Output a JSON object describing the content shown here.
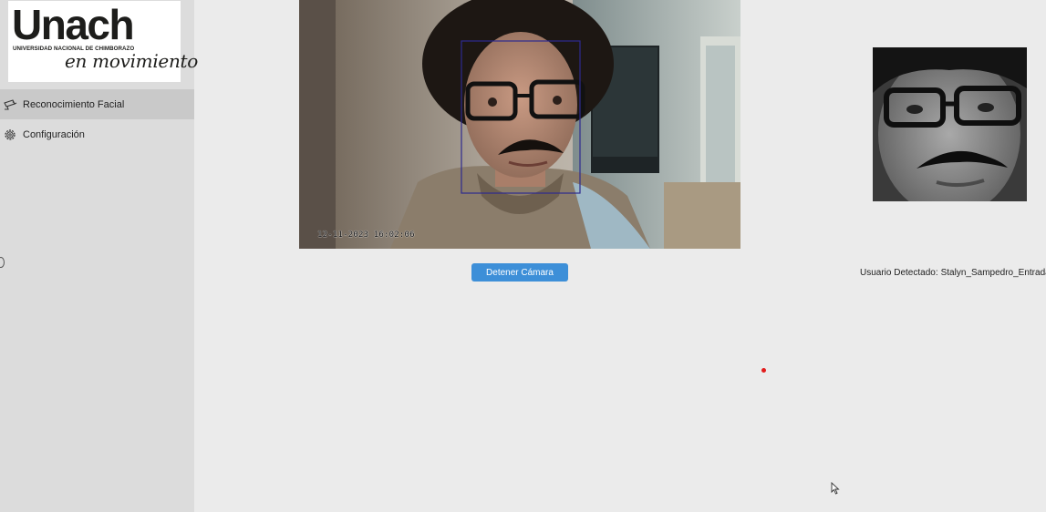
{
  "logo": {
    "main": "Unach",
    "subtitle": "UNIVERSIDAD NACIONAL DE CHIMBORAZO",
    "slogan": "en movimiento"
  },
  "sidebar": {
    "items": [
      {
        "label": "Reconocimiento Facial",
        "icon": "security-camera-icon",
        "active": true
      },
      {
        "label": "Configuración",
        "icon": "gear-icon",
        "active": false
      }
    ]
  },
  "camera": {
    "timestamp": "12-11-2023 16:02:06",
    "stop_label": "Detener Cámara"
  },
  "detection": {
    "label": "Usuario Detectado:",
    "user": "Stalyn_Sampedro_Entrada"
  },
  "colors": {
    "accent": "#3d8fd8",
    "sidebar_bg": "#dcdcdc",
    "active_item_bg": "#c9c9c9",
    "status_dot": "#e21b1b"
  }
}
